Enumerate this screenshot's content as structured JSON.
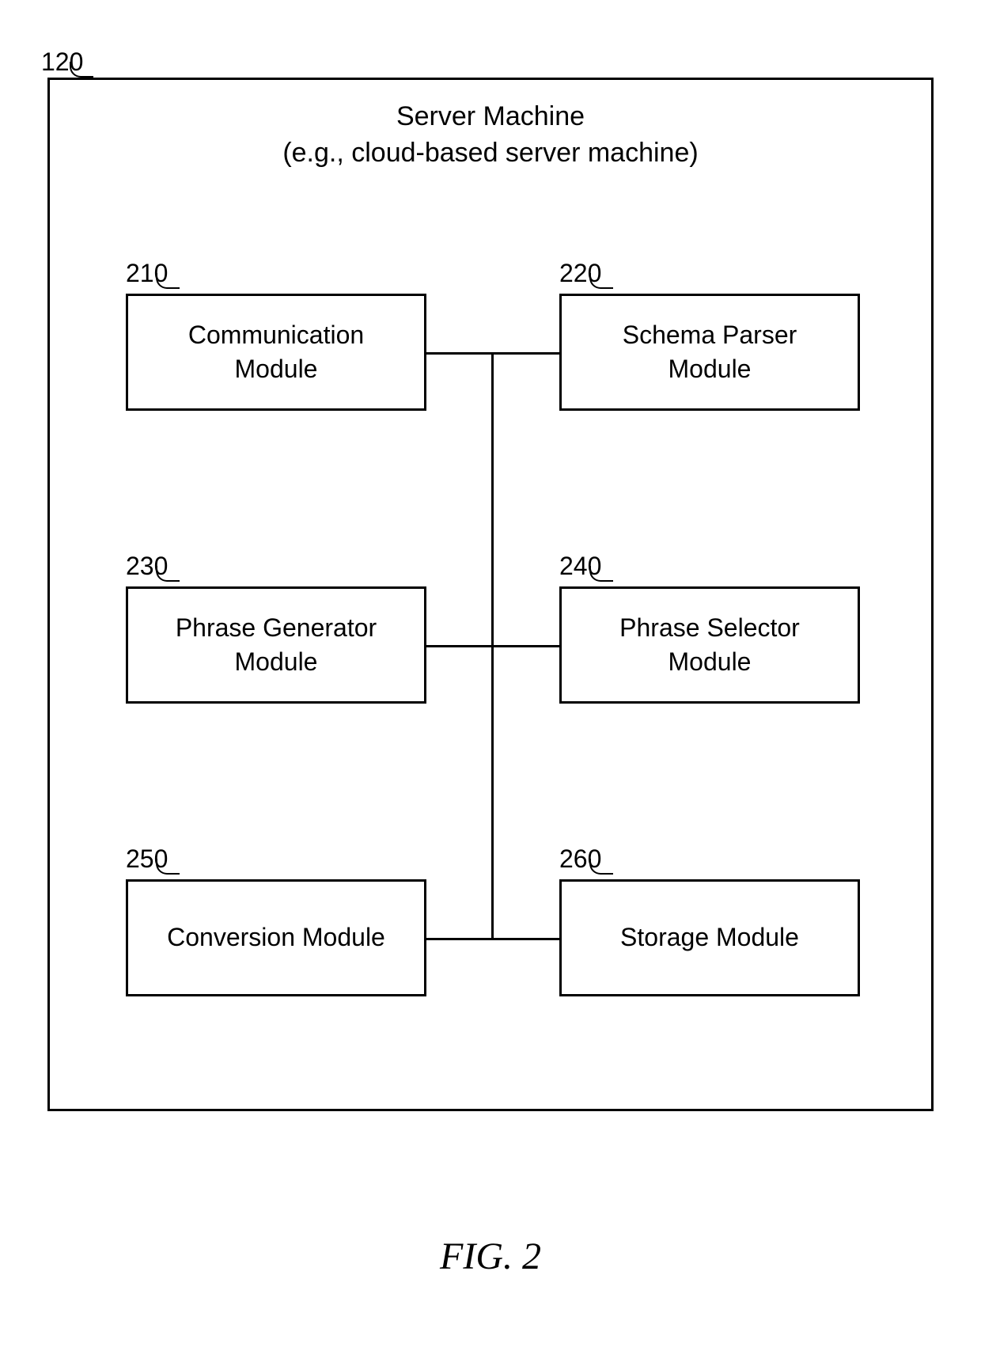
{
  "outer_ref": "120",
  "header": {
    "line1": "Server Machine",
    "line2": "(e.g., cloud-based server machine)"
  },
  "modules": {
    "m210": {
      "ref": "210",
      "line1": "Communication",
      "line2": "Module"
    },
    "m220": {
      "ref": "220",
      "line1": "Schema Parser",
      "line2": "Module"
    },
    "m230": {
      "ref": "230",
      "line1": "Phrase Generator",
      "line2": "Module"
    },
    "m240": {
      "ref": "240",
      "line1": "Phrase Selector",
      "line2": "Module"
    },
    "m250": {
      "ref": "250",
      "label": "Conversion Module"
    },
    "m260": {
      "ref": "260",
      "label": "Storage Module"
    }
  },
  "caption": "FIG. 2"
}
